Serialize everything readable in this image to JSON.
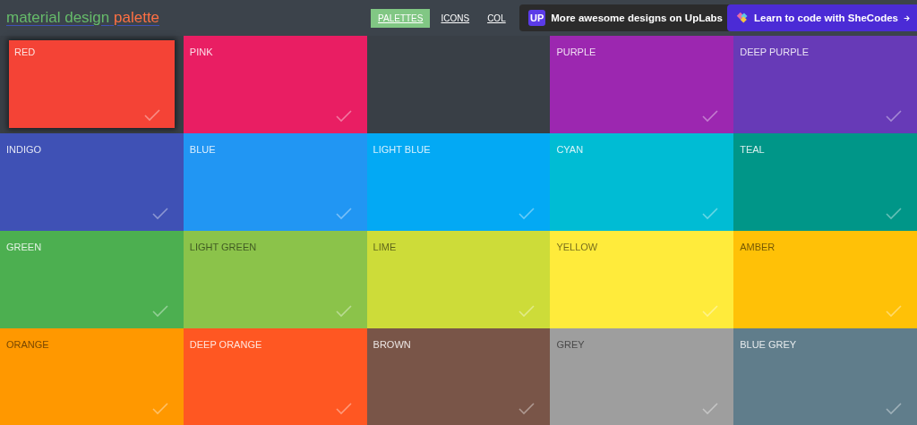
{
  "logo": {
    "part_1": "material design",
    "part_2": "palette"
  },
  "nav": [
    {
      "label": "PALETTES",
      "selected": true
    },
    {
      "label": "ICONS",
      "selected": false
    },
    {
      "label": "COL",
      "selected": false
    }
  ],
  "banners": [
    {
      "kind": "uplabs",
      "text": "More awesome designs on UpLabs",
      "badge": "UP"
    },
    {
      "kind": "shecodes",
      "text": "Learn to code with SheCodes"
    }
  ],
  "tiles": [
    {
      "kind": "color",
      "name": "RED",
      "color": "#f44336",
      "dark_text": false,
      "selected": true
    },
    {
      "kind": "color",
      "name": "PINK",
      "color": "#e91e63",
      "dark_text": false,
      "selected": false
    },
    {
      "kind": "empty"
    },
    {
      "kind": "color",
      "name": "PURPLE",
      "color": "#9c27b0",
      "dark_text": false,
      "selected": false
    },
    {
      "kind": "color",
      "name": "DEEP PURPLE",
      "color": "#673ab7",
      "dark_text": false,
      "selected": false
    },
    {
      "kind": "color",
      "name": "INDIGO",
      "color": "#3f51b5",
      "dark_text": false,
      "selected": false
    },
    {
      "kind": "color",
      "name": "BLUE",
      "color": "#2196f3",
      "dark_text": false,
      "selected": false
    },
    {
      "kind": "color",
      "name": "LIGHT BLUE",
      "color": "#03a9f4",
      "dark_text": false,
      "selected": false
    },
    {
      "kind": "color",
      "name": "CYAN",
      "color": "#00bcd4",
      "dark_text": false,
      "selected": false
    },
    {
      "kind": "color",
      "name": "TEAL",
      "color": "#009688",
      "dark_text": false,
      "selected": false
    },
    {
      "kind": "color",
      "name": "GREEN",
      "color": "#4caf50",
      "dark_text": false,
      "selected": false
    },
    {
      "kind": "color",
      "name": "LIGHT GREEN",
      "color": "#8bc34a",
      "dark_text": true,
      "selected": false
    },
    {
      "kind": "color",
      "name": "LIME",
      "color": "#cddc39",
      "dark_text": true,
      "selected": false
    },
    {
      "kind": "color",
      "name": "YELLOW",
      "color": "#ffeb3b",
      "dark_text": true,
      "selected": false
    },
    {
      "kind": "color",
      "name": "AMBER",
      "color": "#ffc107",
      "dark_text": true,
      "selected": false
    },
    {
      "kind": "color",
      "name": "ORANGE",
      "color": "#ff9800",
      "dark_text": true,
      "selected": false
    },
    {
      "kind": "color",
      "name": "DEEP ORANGE",
      "color": "#ff5722",
      "dark_text": false,
      "selected": false
    },
    {
      "kind": "color",
      "name": "BROWN",
      "color": "#795548",
      "dark_text": false,
      "selected": false
    },
    {
      "kind": "color",
      "name": "GREY",
      "color": "#9e9e9e",
      "dark_text": true,
      "selected": false
    },
    {
      "kind": "color",
      "name": "BLUE GREY",
      "color": "#607d8b",
      "dark_text": false,
      "selected": false
    }
  ]
}
